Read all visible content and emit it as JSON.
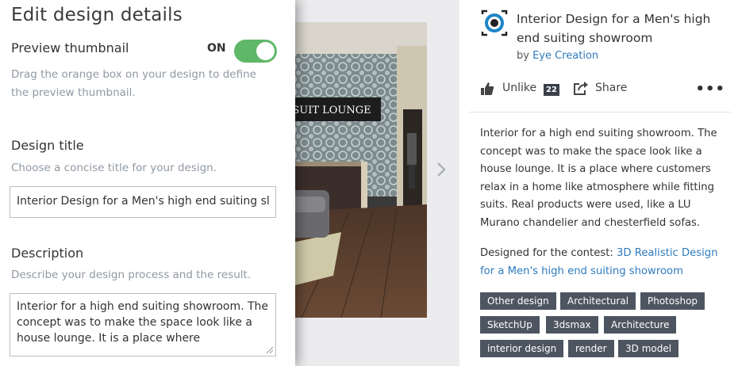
{
  "edit_panel": {
    "title": "Edit design details",
    "preview": {
      "label": "Preview thumbnail",
      "toggle_state": "ON",
      "help": "Drag the orange box on your design to define the preview thumbnail."
    },
    "design_title": {
      "label": "Design title",
      "help": "Choose a concise title for your design.",
      "value": "Interior Design for a Men's high end suiting sl"
    },
    "description": {
      "label": "Description",
      "help": "Describe your design process and the result.",
      "value": "Interior for a high end suiting showroom. The concept was to make the space look like a house lounge. It is a place where"
    }
  },
  "image": {
    "sign_text": "SUIT LOUNGE"
  },
  "info": {
    "title": "Interior Design for a Men's high end suiting showroom",
    "by_prefix": "by",
    "author": "Eye Creation",
    "actions": {
      "unlike_label": "Unlike",
      "like_count": "22",
      "share_label": "Share",
      "more": "•••"
    },
    "description": "Interior for a high end suiting showroom. The concept was to make the space look like a house lounge. It is a place where customers relax in a home like atmosphere while fitting suits. Real products were used, like a LU Murano chandelier and chesterfield sofas.",
    "contest_prefix": "Designed for the contest:",
    "contest_link": "3D Realistic Design for a Men's high end suiting showroom",
    "tags": [
      "Other design",
      "Architectural",
      "Photoshop",
      "SketchUp",
      "3dsmax",
      "Architecture",
      "interior design",
      "render",
      "3D model"
    ]
  },
  "colors": {
    "toggle_on": "#5fb768",
    "link": "#2e7bbf",
    "tag_bg": "#4d5561",
    "help_text": "#8f99a3"
  }
}
